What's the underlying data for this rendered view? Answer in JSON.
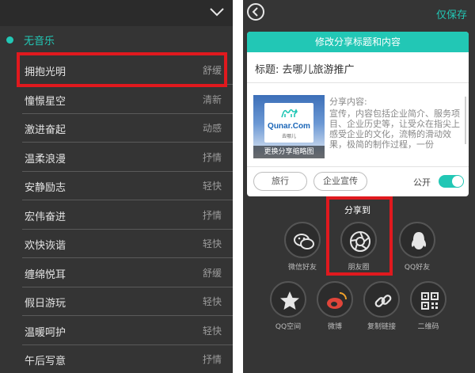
{
  "music_picker": {
    "none_label": "无音乐",
    "tracks": [
      {
        "name": "拥抱光明",
        "mood": "舒缓"
      },
      {
        "name": "憧憬星空",
        "mood": "清新"
      },
      {
        "name": "激进奋起",
        "mood": "动感"
      },
      {
        "name": "温柔浪漫",
        "mood": "抒情"
      },
      {
        "name": "安静励志",
        "mood": "轻快"
      },
      {
        "name": "宏伟奋进",
        "mood": "抒情"
      },
      {
        "name": "欢快诙谐",
        "mood": "轻快"
      },
      {
        "name": "缠绵悦耳",
        "mood": "舒缓"
      },
      {
        "name": "假日游玩",
        "mood": "轻快"
      },
      {
        "name": "温暖呵护",
        "mood": "轻快"
      },
      {
        "name": "午后写意",
        "mood": "抒情"
      }
    ]
  },
  "share_screen": {
    "save_only": "仅保存",
    "card_title": "修改分享标题和内容",
    "title_label": "标题:",
    "title_value": "去哪儿旅游推广",
    "thumbnail": {
      "logo_text": "Qunar.Com",
      "logo_sub": "去哪儿",
      "change_label": "更换分享缩略图"
    },
    "content_label": "分享内容:",
    "content_text": "宣传，内容包括企业简介、服务项目、企业历史等，让受众在指尖上感受企业的文化，流畅的滑动效果，极简的制作过程，一份",
    "tags": [
      "旅行",
      "企业宣传"
    ],
    "public_label": "公开",
    "public_on": true,
    "share_to": "分享到",
    "targets": [
      {
        "label": "微信好友",
        "icon": "wechat-icon"
      },
      {
        "label": "朋友圈",
        "icon": "moments-aperture-icon"
      },
      {
        "label": "QQ好友",
        "icon": "qq-penguin-icon"
      },
      {
        "label": "QQ空间",
        "icon": "qzone-star-icon"
      },
      {
        "label": "微博",
        "icon": "weibo-icon"
      },
      {
        "label": "复制链接",
        "icon": "link-icon"
      },
      {
        "label": "二维码",
        "icon": "qrcode-icon"
      }
    ]
  },
  "colors": {
    "accent": "#22c7b5",
    "highlight": "#e0191e",
    "panel_bg": "#343434"
  }
}
